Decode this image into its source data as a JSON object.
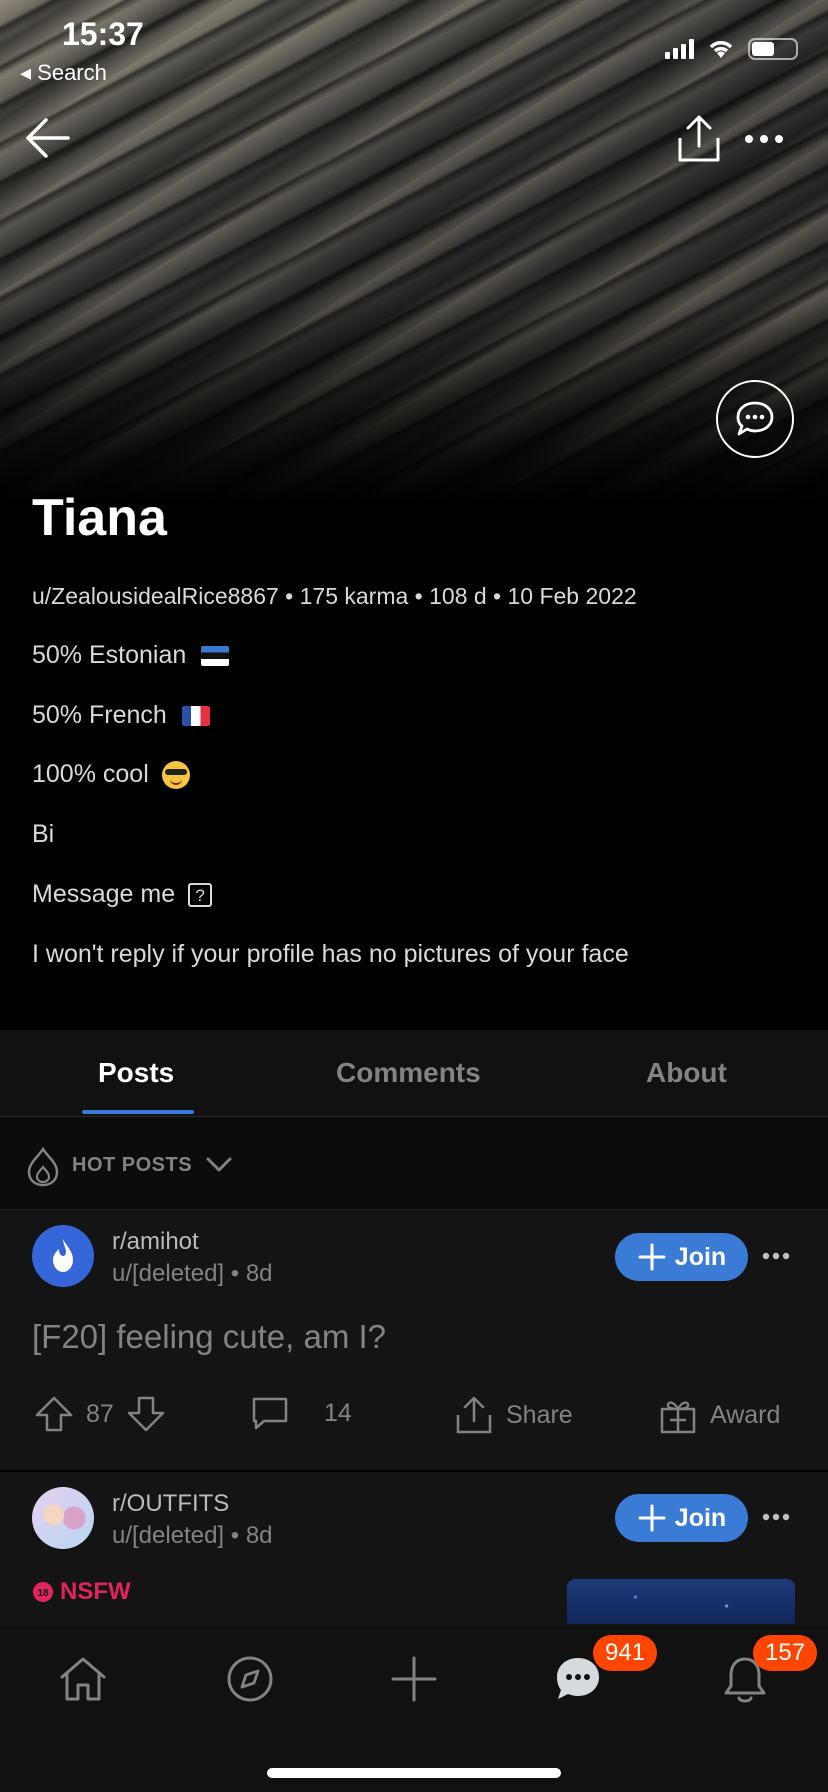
{
  "status_bar": {
    "time": "15:37",
    "back_label": "◂ Search"
  },
  "profile": {
    "display_name": "Tiana",
    "meta_line": "u/ZealousidealRice8867 • 175 karma • 108 d • 10 Feb 2022",
    "bio": {
      "line1": "50% Estonian",
      "line2": "50% French",
      "line3": "100% cool",
      "line4": "Bi",
      "line5": "Message me",
      "line5_box": "?",
      "line6": "I won't reply if your profile has no pictures of your face"
    }
  },
  "tabs": {
    "posts": "Posts",
    "comments": "Comments",
    "about": "About",
    "active": "Posts"
  },
  "sort": {
    "label": "HOT POSTS"
  },
  "posts": [
    {
      "subreddit": "r/amihot",
      "meta": "u/[deleted] • 8d",
      "join_label": "Join",
      "title": "[F20] feeling cute, am I?",
      "score": "87",
      "comments": "14",
      "share_label": "Share",
      "award_label": "Award"
    },
    {
      "subreddit": "r/OUTFITS",
      "meta": "u/[deleted] • 8d",
      "join_label": "Join",
      "nsfw_label": "NSFW"
    }
  ],
  "bottom_nav": {
    "chat_badge": "941",
    "notifications_badge": "157"
  },
  "colors": {
    "accent": "#3a7bd5",
    "badge": "#ff4500",
    "nsfw": "#e0245e",
    "muted": "#818384"
  }
}
